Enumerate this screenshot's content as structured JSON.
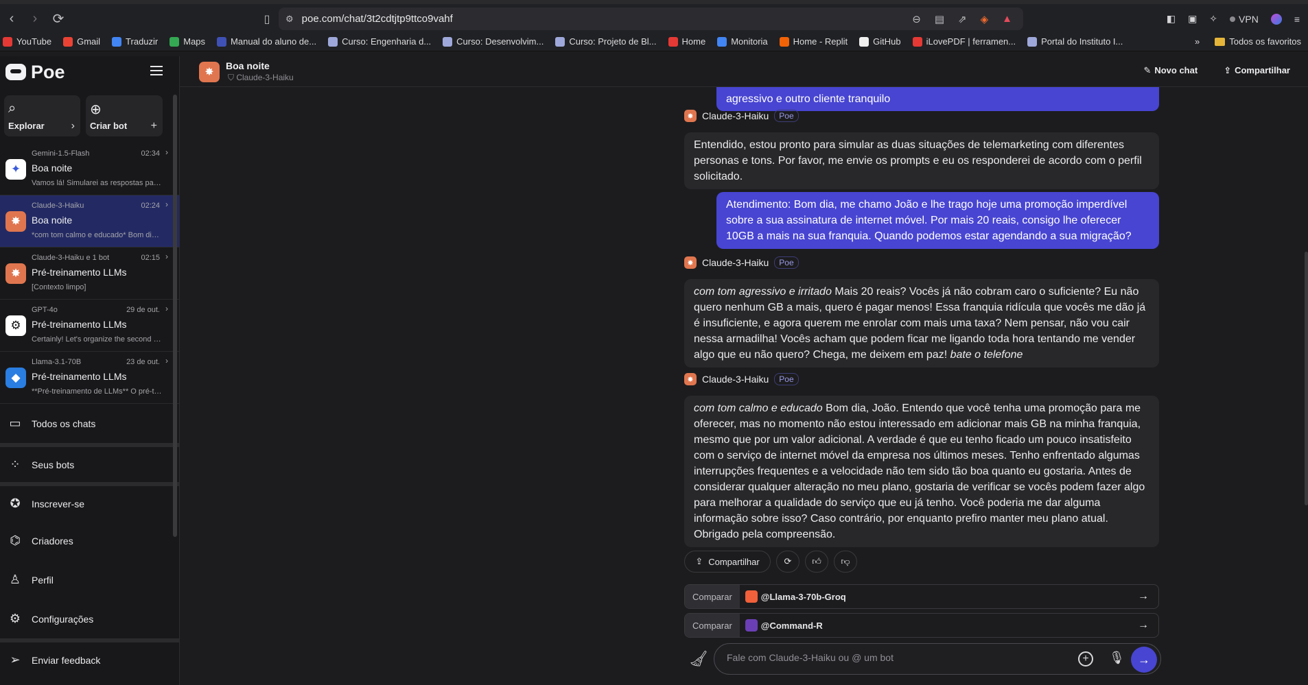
{
  "browser": {
    "url": "poe.com/chat/3t2cdtjtp9ttco9vahf",
    "vpn_label": "VPN",
    "bookmarks": [
      {
        "label": "YouTube",
        "color": "#e53935"
      },
      {
        "label": "Gmail",
        "color": "#ea4335"
      },
      {
        "label": "Traduzir",
        "color": "#4285f4"
      },
      {
        "label": "Maps",
        "color": "#34a853"
      },
      {
        "label": "Manual do aluno de...",
        "color": "#3f51b5"
      },
      {
        "label": "Curso: Engenharia d...",
        "color": "#9fa8da"
      },
      {
        "label": "Curso: Desenvolvim...",
        "color": "#9fa8da"
      },
      {
        "label": "Curso: Projeto de Bl...",
        "color": "#9fa8da"
      },
      {
        "label": "Home",
        "color": "#e53935"
      },
      {
        "label": "Monitoria",
        "color": "#4285f4"
      },
      {
        "label": "Home - Replit",
        "color": "#f26207"
      },
      {
        "label": "GitHub",
        "color": "#f0f0f0"
      },
      {
        "label": "iLovePDF | ferramen...",
        "color": "#e53935"
      },
      {
        "label": "Portal do Instituto I...",
        "color": "#9fa8da"
      }
    ],
    "more_label": "»",
    "favorites_label": "Todos os favoritos"
  },
  "sidebar": {
    "logo": "Poe",
    "explore_label": "Explorar",
    "create_label": "Criar bot",
    "chats": [
      {
        "bot": "Gemini-1.5-Flash",
        "time": "02:34",
        "title": "Boa noite",
        "preview": "Vamos lá! Simularei as respostas para ...",
        "glyph": "✦",
        "bg": "#ffffff",
        "fg": "#3a5bd9"
      },
      {
        "bot": "Claude-3-Haiku",
        "time": "02:24",
        "title": "Boa noite",
        "preview": "*com tom calmo e educado* Bom dia,...",
        "glyph": "✸",
        "bg": "#e0764f",
        "fg": "#ffffff"
      },
      {
        "bot": "Claude-3-Haiku e 1 bot",
        "time": "02:15",
        "title": "Pré-treinamento LLMs",
        "preview": "[Contexto limpo]",
        "glyph": "✸",
        "bg": "#e0764f",
        "fg": "#ffffff"
      },
      {
        "bot": "GPT-4o",
        "time": "29 de out.",
        "title": "Pré-treinamento LLMs",
        "preview": "Certainly! Let's organize the second p...",
        "glyph": "⚙",
        "bg": "#ffffff",
        "fg": "#111111"
      },
      {
        "bot": "Llama-3.1-70B",
        "time": "23 de out.",
        "title": "Pré-treinamento LLMs",
        "preview": "**Pré-treinamento de LLMs** O pré-tr...",
        "glyph": "◆",
        "bg": "#2a7de1",
        "fg": "#ffffff"
      }
    ],
    "nav": {
      "all_chats": "Todos os chats",
      "your_bots": "Seus bots",
      "subscribe": "Inscrever-se",
      "creators": "Criadores",
      "profile": "Perfil",
      "settings": "Configurações",
      "feedback": "Enviar feedback"
    }
  },
  "header": {
    "title": "Boa noite",
    "bot_name": "Claude-3-Haiku",
    "new_chat": "Novo chat",
    "share": "Compartilhar"
  },
  "messages": {
    "user_0": "agressivo e outro cliente tranquilo",
    "bot_label": "Claude-3-Haiku",
    "poe_tag": "Poe",
    "bot_1": "Entendido, estou pronto para simular as duas situações de telemarketing com diferentes personas e tons. Por favor, me envie os prompts e eu os responderei de acordo com o perfil solicitado.",
    "user_2": "Atendimento: Bom dia, me chamo João e lhe trago hoje uma promoção imperdível sobre a sua assinatura de internet móvel. Por mais 20 reais, consigo lhe oferecer 10GB a mais na sua franquia. Quando podemos estar agendando a sua migração?",
    "bot_3_em": "com tom agressivo e irritado",
    "bot_3": " Mais 20 reais? Vocês já não cobram caro o suficiente? Eu não quero nenhum GB a mais, quero é pagar menos! Essa franquia ridícula que vocês me dão já é insuficiente, e agora querem me enrolar com mais uma taxa? Nem pensar, não vou cair nessa armadilha! Vocês acham que podem ficar me ligando toda hora tentando me vender algo que eu não quero? Chega, me deixem em paz! ",
    "bot_3_end": "bate o telefone",
    "bot_4_em": "com tom calmo e educado",
    "bot_4": " Bom dia, João. Entendo que você tenha uma promoção para me oferecer, mas no momento não estou interessado em adicionar mais GB na minha franquia, mesmo que por um valor adicional. A verdade é que eu tenho ficado um pouco insatisfeito com o serviço de internet móvel da empresa nos últimos meses. Tenho enfrentado algumas interrupções frequentes e a velocidade não tem sido tão boa quanto eu gostaria. Antes de considerar qualquer alteração no meu plano, gostaria de verificar se vocês podem fazer algo para melhorar a qualidade do serviço que eu já tenho. Você poderia me dar alguma informação sobre isso? Caso contrário, por enquanto prefiro manter meu plano atual. Obrigado pela compreensão."
  },
  "actions": {
    "share": "Compartilhar"
  },
  "compare": {
    "label": "Comparar",
    "bot_1": "@Llama-3-70b-Groq",
    "bot_2": "@Command-R"
  },
  "composer": {
    "placeholder": "Fale com Claude-3-Haiku ou @ um bot"
  }
}
